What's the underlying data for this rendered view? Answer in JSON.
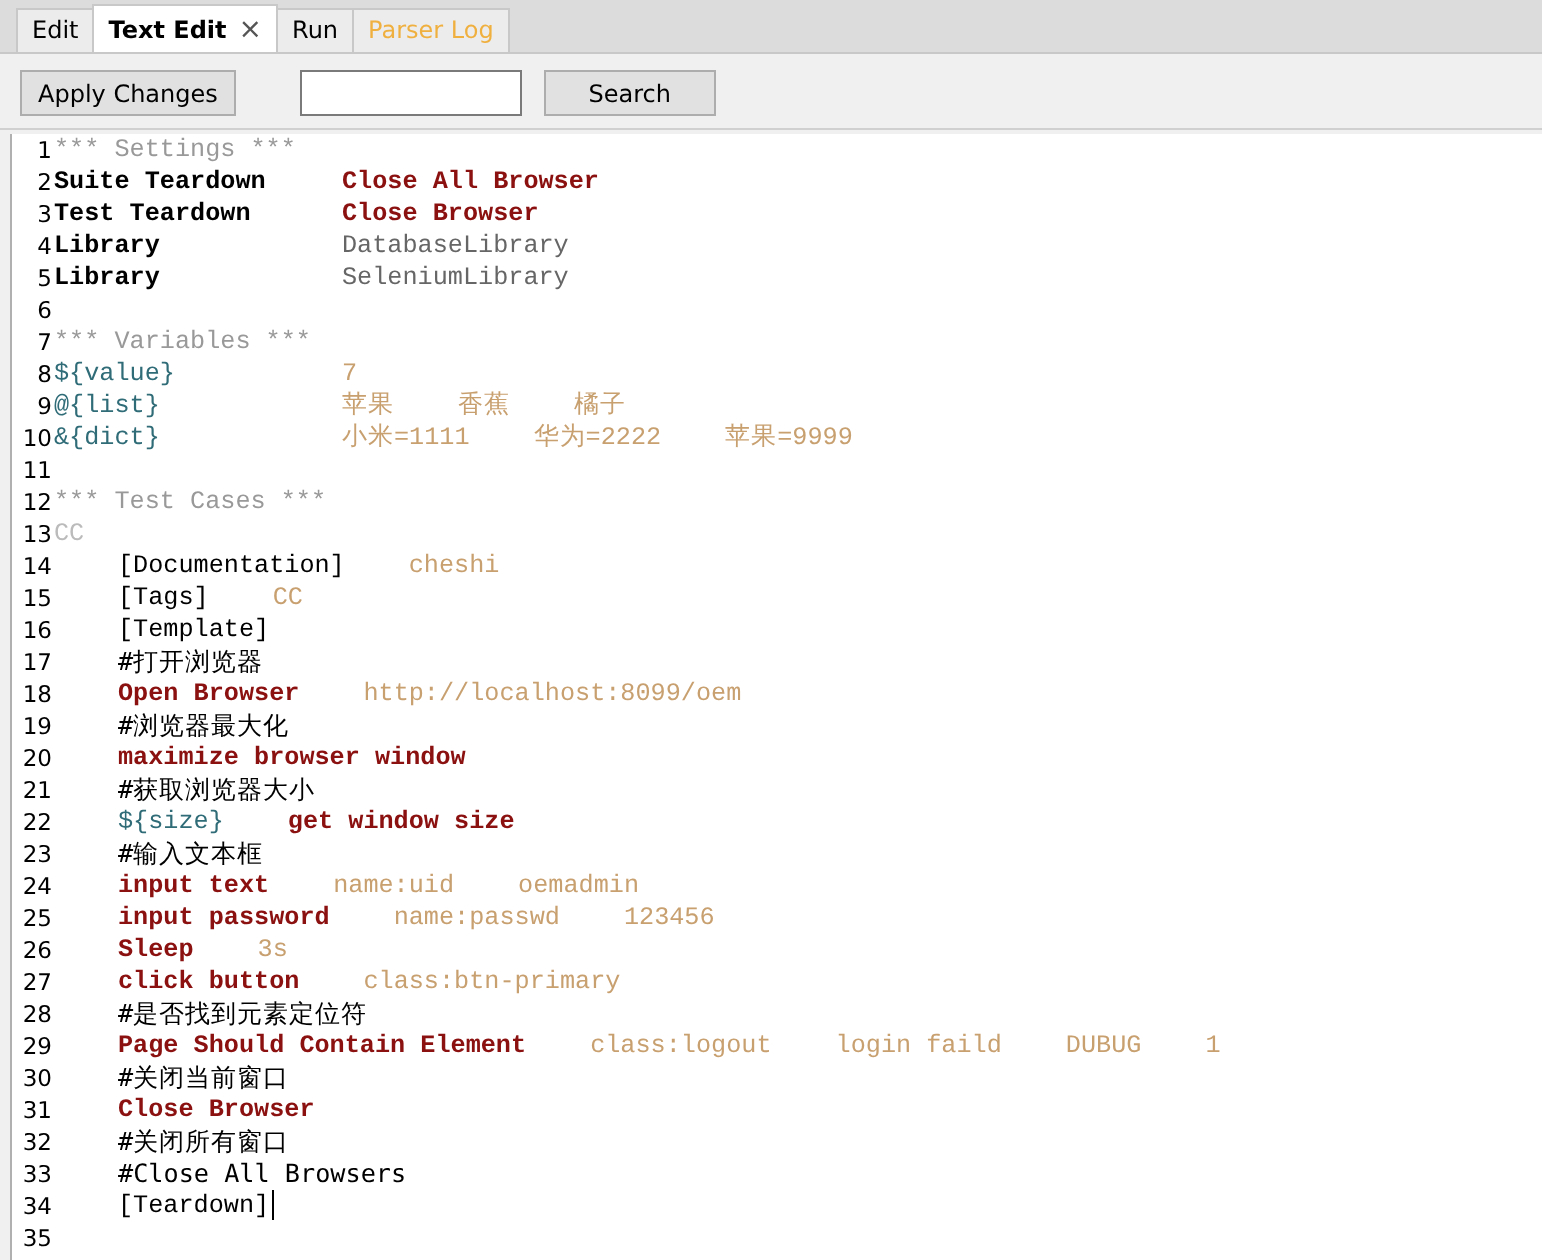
{
  "tabs": [
    {
      "label": "Edit",
      "selected": false,
      "kind": "plain"
    },
    {
      "label": "Text Edit",
      "selected": true,
      "kind": "plain",
      "close": "×"
    },
    {
      "label": "Run",
      "selected": false,
      "kind": "plain"
    },
    {
      "label": "Parser Log",
      "selected": false,
      "kind": "log"
    }
  ],
  "toolbar": {
    "apply_button": "Apply Changes",
    "search_button": "Search"
  },
  "editor": {
    "lines": [
      {
        "number": "1",
        "indent": false,
        "tokens": [
          {
            "kind": "section",
            "text": "*** Settings ***"
          }
        ]
      },
      {
        "number": "2",
        "indent": false,
        "tokens": [
          {
            "kind": "setting",
            "text": "Suite Teardown"
          },
          {
            "kind": "keyword",
            "text": "Close All Browser"
          }
        ]
      },
      {
        "number": "3",
        "indent": false,
        "tokens": [
          {
            "kind": "setting",
            "text": "Test Teardown"
          },
          {
            "kind": "keyword",
            "text": "Close Browser"
          }
        ]
      },
      {
        "number": "4",
        "indent": false,
        "tokens": [
          {
            "kind": "setting",
            "text": "Library"
          },
          {
            "kind": "library",
            "text": "DatabaseLibrary"
          }
        ]
      },
      {
        "number": "5",
        "indent": false,
        "tokens": [
          {
            "kind": "setting",
            "text": "Library"
          },
          {
            "kind": "library",
            "text": "SeleniumLibrary"
          }
        ]
      },
      {
        "number": "6",
        "indent": false
      },
      {
        "number": "7",
        "indent": false,
        "tokens": [
          {
            "kind": "section",
            "text": "*** Variables ***"
          }
        ]
      },
      {
        "number": "8",
        "indent": false,
        "tokens": [
          {
            "kind": "variable",
            "text": "${value}"
          },
          {
            "kind": "arg",
            "text": "7"
          }
        ]
      },
      {
        "number": "9",
        "indent": false,
        "tokens": [
          {
            "kind": "variable",
            "text": "@{list}"
          },
          {
            "kind": "arg",
            "text": "苹果"
          },
          {
            "kind": "arg",
            "text": "香蕉"
          },
          {
            "kind": "arg",
            "text": "橘子"
          }
        ]
      },
      {
        "number": "10",
        "indent": false,
        "tokens": [
          {
            "kind": "variable",
            "text": "&{dict}"
          },
          {
            "kind": "arg",
            "text": "小米=1111"
          },
          {
            "kind": "arg",
            "text": "华为=2222"
          },
          {
            "kind": "arg",
            "text": "苹果=9999"
          }
        ]
      },
      {
        "number": "11",
        "indent": false
      },
      {
        "number": "12",
        "indent": false,
        "tokens": [
          {
            "kind": "section",
            "text": "*** Test Cases ***"
          }
        ]
      },
      {
        "number": "13",
        "indent": false,
        "tokens": [
          {
            "kind": "testname",
            "text": "CC"
          }
        ]
      },
      {
        "number": "14",
        "indent": true,
        "tokens": [
          {
            "kind": "bracket",
            "text": "[Documentation]"
          },
          {
            "kind": "arg",
            "text": "cheshi"
          }
        ]
      },
      {
        "number": "15",
        "indent": true,
        "tokens": [
          {
            "kind": "bracket",
            "text": "[Tags]"
          },
          {
            "kind": "arg",
            "text": "CC"
          }
        ]
      },
      {
        "number": "16",
        "indent": true,
        "tokens": [
          {
            "kind": "bracket",
            "text": "[Template]"
          }
        ]
      },
      {
        "number": "17",
        "indent": true,
        "tokens": [
          {
            "kind": "comment",
            "text": "#打开浏览器"
          }
        ]
      },
      {
        "number": "18",
        "indent": true,
        "tokens": [
          {
            "kind": "keyword",
            "text": "Open Browser"
          },
          {
            "kind": "arg",
            "text": "http://localhost:8099/oem"
          }
        ]
      },
      {
        "number": "19",
        "indent": true,
        "tokens": [
          {
            "kind": "comment",
            "text": "#浏览器最大化"
          }
        ]
      },
      {
        "number": "20",
        "indent": true,
        "tokens": [
          {
            "kind": "keyword",
            "text": "maximize browser window"
          }
        ]
      },
      {
        "number": "21",
        "indent": true,
        "tokens": [
          {
            "kind": "comment",
            "text": "#获取浏览器大小"
          }
        ]
      },
      {
        "number": "22",
        "indent": true,
        "tokens": [
          {
            "kind": "variable",
            "text": "${size}"
          },
          {
            "kind": "keyword",
            "text": "get window size"
          }
        ]
      },
      {
        "number": "23",
        "indent": true,
        "tokens": [
          {
            "kind": "comment",
            "text": "#输入文本框"
          }
        ]
      },
      {
        "number": "24",
        "indent": true,
        "tokens": [
          {
            "kind": "keyword",
            "text": "input text"
          },
          {
            "kind": "arg",
            "text": "name:uid"
          },
          {
            "kind": "arg",
            "text": "oemadmin"
          }
        ]
      },
      {
        "number": "25",
        "indent": true,
        "tokens": [
          {
            "kind": "keyword",
            "text": "input password"
          },
          {
            "kind": "arg",
            "text": "name:passwd"
          },
          {
            "kind": "arg",
            "text": "123456"
          }
        ]
      },
      {
        "number": "26",
        "indent": true,
        "tokens": [
          {
            "kind": "keyword",
            "text": "Sleep"
          },
          {
            "kind": "arg",
            "text": "3s"
          }
        ]
      },
      {
        "number": "27",
        "indent": true,
        "tokens": [
          {
            "kind": "keyword",
            "text": "click button"
          },
          {
            "kind": "arg",
            "text": "class:btn-primary"
          }
        ]
      },
      {
        "number": "28",
        "indent": true,
        "tokens": [
          {
            "kind": "comment",
            "text": "#是否找到元素定位符"
          }
        ]
      },
      {
        "number": "29",
        "indent": true,
        "tokens": [
          {
            "kind": "keyword",
            "text": "Page Should Contain Element"
          },
          {
            "kind": "arg",
            "text": "class:logout"
          },
          {
            "kind": "arg",
            "text": "login faild"
          },
          {
            "kind": "arg",
            "text": "DUBUG"
          },
          {
            "kind": "arg",
            "text": "1"
          }
        ]
      },
      {
        "number": "30",
        "indent": true,
        "tokens": [
          {
            "kind": "comment",
            "text": "#关闭当前窗口"
          }
        ]
      },
      {
        "number": "31",
        "indent": true,
        "tokens": [
          {
            "kind": "keyword",
            "text": "Close Browser"
          }
        ]
      },
      {
        "number": "32",
        "indent": true,
        "tokens": [
          {
            "kind": "comment",
            "text": "#关闭所有窗口"
          }
        ]
      },
      {
        "number": "33",
        "indent": true,
        "tokens": [
          {
            "kind": "comment",
            "text": "#Close All Browsers"
          }
        ]
      },
      {
        "number": "34",
        "indent": true,
        "caret": true,
        "tokens": [
          {
            "kind": "bracket",
            "text": "[Teardown]"
          }
        ]
      },
      {
        "number": "35",
        "indent": false
      }
    ]
  }
}
